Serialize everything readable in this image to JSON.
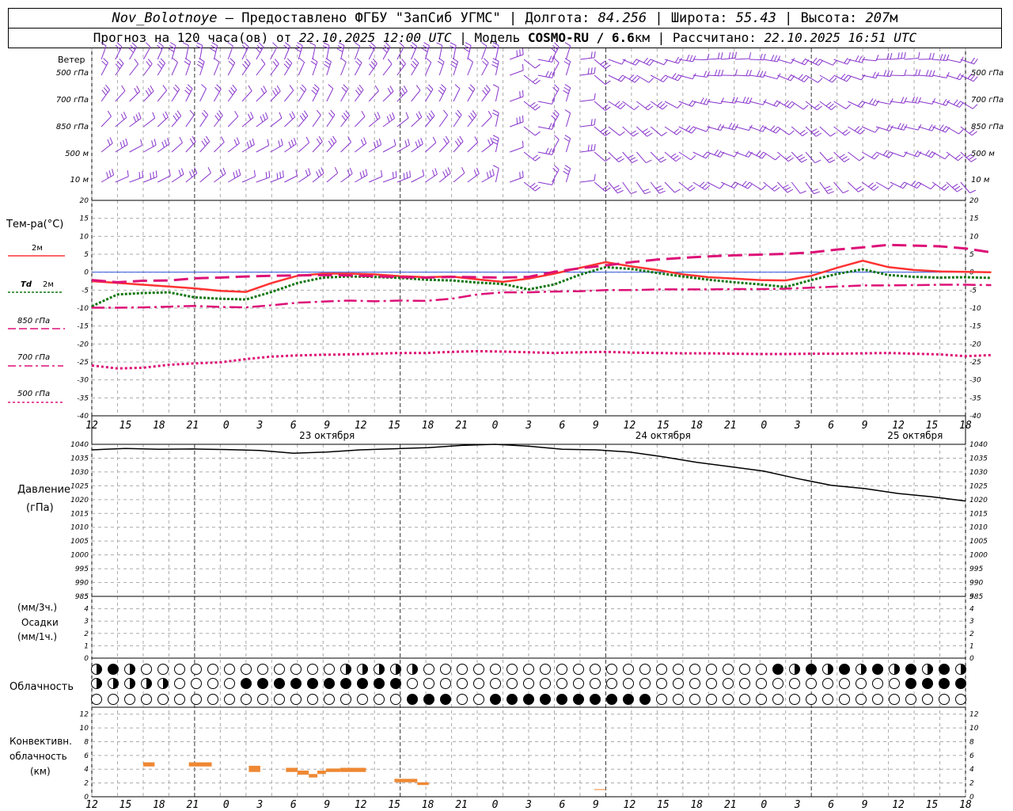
{
  "header": {
    "station": "Nov_Bolotnoye",
    "provider": "Предоставлено ФГБУ \"ЗапСиб УГМС\"",
    "lon_label": "Долгота:",
    "lon": "84.256",
    "lat_label": "Широта:",
    "lat": "55.43",
    "alt_label": "Высота:",
    "alt": "207",
    "alt_unit": "м",
    "forecast_label": "Прогноз на 120 часа(ов) от",
    "start": "22.10.2025 12:00 UTC",
    "model_label": "Модель",
    "model": "COSMO-RU / 6.6",
    "model_unit": "км",
    "calc_label": "Рассчитано:",
    "calc": "22.10.2025 16:51 UTC"
  },
  "labels": {
    "wind_title": "Ветер",
    "wind_levels": [
      "500 гПа",
      "700 гПа",
      "850 гПа",
      "500 м",
      "10 м"
    ],
    "temp_title": "Тем-ра(°C)",
    "legend_2m": "2м",
    "legend_td": "Td",
    "legend_td_suffix": "2м",
    "legend_850": "850 гПа",
    "legend_700": "700 гПа",
    "legend_500": "500 гПа",
    "pressure_title": "Давление",
    "pressure_unit": "(гПа)",
    "precip_3h": "(мм/3ч.)",
    "precip_title": "Осадки",
    "precip_1h": "(мм/1ч.)",
    "cloud_title": "Облачность",
    "conv_title1": "Конвективн.",
    "conv_title2": "облачность",
    "conv_unit": "(км)"
  },
  "colors": {
    "t2m": "#ff3333",
    "td": "#117711",
    "t850": "#dd1177",
    "t700": "#dd1177",
    "t500": "#dd1177",
    "wind": "#8833cc",
    "pressure": "#000000",
    "conv": "#ee8833",
    "grid": "#aaaaaa",
    "zero_line": "#3355dd"
  },
  "chart_data": [
    {
      "type": "wind_barbs",
      "levels": [
        "500 гПа",
        "700 гПа",
        "850 гПа",
        "500 м",
        "10 м"
      ]
    },
    {
      "type": "line",
      "ylim": [
        -40,
        20
      ],
      "yticks": [
        20,
        15,
        10,
        5,
        0,
        -5,
        -10,
        -15,
        -20,
        -25,
        -30,
        -35,
        -40
      ],
      "x_hours": [
        0,
        9,
        18,
        27,
        36,
        45,
        54,
        63,
        72,
        81,
        90,
        99,
        108,
        117,
        126,
        135,
        144,
        153,
        162,
        171,
        180,
        189,
        198,
        207,
        216,
        225,
        234,
        243,
        252,
        261,
        270,
        279,
        288,
        297,
        306,
        315
      ],
      "series": [
        {
          "name": "2м",
          "values": [
            -2.5,
            -3,
            -3.5,
            -4,
            -4.5,
            -5.2,
            -5.5,
            -3,
            -1,
            -0.4,
            -0.4,
            -0.6,
            -1.1,
            -1.4,
            -1.2,
            -2,
            -2.7,
            -1.8,
            -0.4,
            1.2,
            2.8,
            1.6,
            0.6,
            -0.6,
            -1.4,
            -1.8,
            -2.2,
            -2.3,
            -1,
            1.2,
            3.2,
            1.4,
            0.6,
            0.2,
            0.1,
            0
          ]
        },
        {
          "name": "Td 2м",
          "values": [
            -9.5,
            -6.2,
            -5.8,
            -5.6,
            -7,
            -7.4,
            -7.6,
            -5.5,
            -3,
            -1.5,
            -1.2,
            -1.3,
            -1.6,
            -2.1,
            -2.3,
            -2.9,
            -3.3,
            -4.8,
            -3.4,
            -0.7,
            1.4,
            0.9,
            -0.2,
            -1.2,
            -2.1,
            -2.8,
            -3.4,
            -4.1,
            -2.2,
            -0.5,
            0.8,
            -0.8,
            -1.3,
            -1.5,
            -1.4,
            -1.6
          ]
        },
        {
          "name": "850 гПа",
          "values": [
            -2.2,
            -2.8,
            -2.4,
            -2.3,
            -1.7,
            -1.5,
            -1.2,
            -1,
            -0.9,
            -0.8,
            -0.9,
            -1.1,
            -1.4,
            -1.5,
            -1.3,
            -1.4,
            -1.5,
            -1.3,
            0.1,
            1.1,
            1.9,
            2.8,
            3.5,
            4,
            4.4,
            4.7,
            4.9,
            5.1,
            5.5,
            6.3,
            6.9,
            7.6,
            7.4,
            7.2,
            6.6,
            5.5
          ]
        },
        {
          "name": "700 гПа",
          "values": [
            -9.9,
            -9.9,
            -9.8,
            -9.6,
            -9.4,
            -9.7,
            -9.8,
            -9.2,
            -8.5,
            -8.2,
            -7.9,
            -8.1,
            -7.9,
            -8,
            -7.4,
            -6.2,
            -5.6,
            -5.6,
            -5.4,
            -5.3,
            -5,
            -5,
            -4.8,
            -4.8,
            -4.8,
            -4.7,
            -4.7,
            -4.6,
            -4.3,
            -4,
            -3.7,
            -3.7,
            -3.6,
            -3.5,
            -3.5,
            -3.6
          ]
        },
        {
          "name": "500 гПа",
          "values": [
            -26,
            -26.8,
            -26.6,
            -25.8,
            -25.4,
            -25.1,
            -24.2,
            -23.5,
            -23.2,
            -23,
            -22.9,
            -22.7,
            -22.5,
            -22.5,
            -22.2,
            -22,
            -22.1,
            -22.3,
            -22.5,
            -22.3,
            -22.2,
            -22.4,
            -22.5,
            -22.6,
            -22.6,
            -22.7,
            -22.8,
            -22.8,
            -22.7,
            -22.7,
            -22.6,
            -22.5,
            -22.7,
            -22.9,
            -23.4,
            -23.1
          ]
        }
      ]
    },
    {
      "type": "line",
      "ylim": [
        985,
        1040
      ],
      "yticks": [
        1040,
        1035,
        1030,
        1025,
        1020,
        1015,
        1010,
        1005,
        1000,
        995,
        990,
        985
      ],
      "x_hours": [
        0,
        12,
        24,
        36,
        48,
        60,
        72,
        84,
        96,
        108,
        120,
        132,
        144,
        156,
        168,
        180,
        192,
        204,
        216,
        228,
        240,
        252,
        264,
        276,
        288,
        300,
        312
      ],
      "series": [
        {
          "name": "Давление",
          "values": [
            1038,
            1038.5,
            1038.2,
            1038.3,
            1038.1,
            1037.8,
            1036.8,
            1037.2,
            1038,
            1038.4,
            1038.8,
            1039.6,
            1040,
            1039.3,
            1038.2,
            1038,
            1037.2,
            1035.5,
            1033.5,
            1031.9,
            1030.3,
            1027.6,
            1025.2,
            1024,
            1022.2,
            1021,
            1019.5
          ]
        }
      ]
    },
    {
      "type": "bar",
      "ylim": [
        0,
        5
      ],
      "yticks": [
        5,
        4,
        3,
        2,
        1,
        0
      ],
      "values": []
    },
    {
      "type": "table",
      "rows": 3,
      "columns": 53
    },
    {
      "type": "bar",
      "ylim": [
        0,
        13
      ],
      "yticks": [
        12,
        10,
        8,
        6,
        4,
        2,
        0
      ],
      "segments": [
        {
          "x0": 18,
          "x1": 22,
          "y0": 4.4,
          "y1": 5.0
        },
        {
          "x0": 34,
          "x1": 42,
          "y0": 4.4,
          "y1": 5.0
        },
        {
          "x0": 55,
          "x1": 59,
          "y0": 3.9,
          "y1": 4.5
        },
        {
          "x0": 55,
          "x1": 59,
          "y0": 3.6,
          "y1": 4.0
        },
        {
          "x0": 68,
          "x1": 72,
          "y0": 3.6,
          "y1": 4.2
        },
        {
          "x0": 72,
          "x1": 76,
          "y0": 3.2,
          "y1": 3.8
        },
        {
          "x0": 76,
          "x1": 79,
          "y0": 2.8,
          "y1": 3.3
        },
        {
          "x0": 79,
          "x1": 82,
          "y0": 3.3,
          "y1": 3.8
        },
        {
          "x0": 82,
          "x1": 87,
          "y0": 3.6,
          "y1": 4.1
        },
        {
          "x0": 87,
          "x1": 96,
          "y0": 3.6,
          "y1": 4.2
        },
        {
          "x0": 106,
          "x1": 114,
          "y0": 2.1,
          "y1": 2.6
        },
        {
          "x0": 114,
          "x1": 118,
          "y0": 1.7,
          "y1": 2.1
        },
        {
          "x0": 176,
          "x1": 180,
          "y0": 1.0,
          "y1": 1.1
        }
      ]
    }
  ],
  "time_axis": {
    "hour_labels": [
      "12",
      "15",
      "18",
      "21",
      "0",
      "3",
      "6",
      "9",
      "12",
      "15",
      "18",
      "21",
      "0",
      "3",
      "6",
      "9",
      "12",
      "15",
      "18",
      "21",
      "0",
      "3",
      "6",
      "9",
      "12",
      "15",
      "18"
    ],
    "date_labels": [
      "23 октября",
      "24 октября",
      "25 октября"
    ]
  }
}
